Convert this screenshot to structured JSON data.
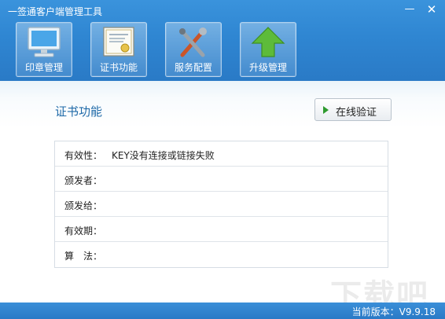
{
  "app": {
    "title": "一签通客户端管理工具"
  },
  "window_controls": {
    "minimize": "—",
    "close": "✕"
  },
  "toolbar": {
    "items": [
      {
        "label": "印章管理",
        "icon": "monitor-icon"
      },
      {
        "label": "证书功能",
        "icon": "certificate-icon"
      },
      {
        "label": "服务配置",
        "icon": "tools-icon"
      },
      {
        "label": "升级管理",
        "icon": "upgrade-arrow-icon"
      }
    ]
  },
  "main": {
    "section_title": "证书功能",
    "verify_button": "在线验证",
    "fields": [
      {
        "key": "有效性：",
        "value": "KEY没有连接或链接失败"
      },
      {
        "key": "颁发者：",
        "value": ""
      },
      {
        "key": "颁发给：",
        "value": ""
      },
      {
        "key": "有效期：",
        "value": ""
      },
      {
        "key": "算　法：",
        "value": ""
      }
    ]
  },
  "status": {
    "version": "当前版本：V9.9.18"
  },
  "watermark": {
    "text": "下载吧"
  },
  "colors": {
    "header": "#2f86d2",
    "accent": "#1f6aa8",
    "play": "#2e9a2e"
  }
}
